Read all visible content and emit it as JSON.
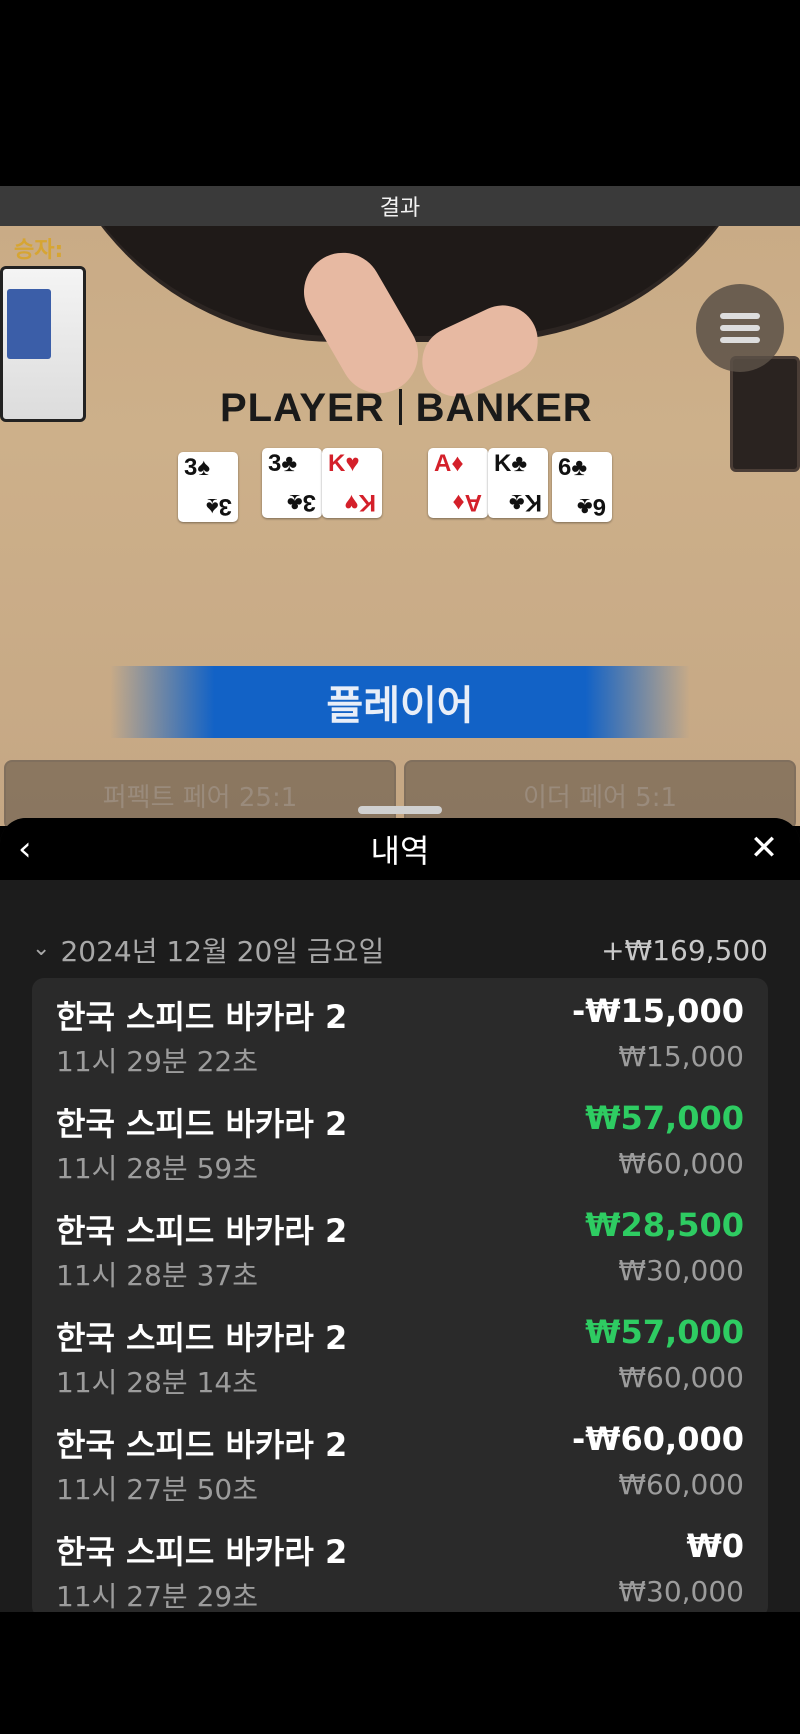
{
  "video": {
    "result_label": "결과",
    "winner_label": "승자:",
    "table_layout": {
      "player": "PLAYER",
      "banker": "BANKER"
    },
    "player_cards": [
      {
        "rank": "3",
        "suit": "♠",
        "color": "black"
      },
      {
        "rank": "3",
        "suit": "♣",
        "color": "black"
      },
      {
        "rank": "K",
        "suit": "♥",
        "color": "red"
      }
    ],
    "banker_cards": [
      {
        "rank": "A",
        "suit": "♦",
        "color": "red"
      },
      {
        "rank": "K",
        "suit": "♣",
        "color": "black"
      },
      {
        "rank": "6",
        "suit": "♣",
        "color": "black"
      }
    ],
    "winner_banner": "플레이어",
    "side_bets": [
      "퍼펙트 페어 25:1",
      "이더 페어 5:1"
    ]
  },
  "sheet": {
    "title": "내역",
    "back_icon": "chevron-left-icon",
    "close_icon": "close-icon",
    "date_group": {
      "date": "2024년 12월 20일 금요일",
      "total": "+₩169,500"
    },
    "rows": [
      {
        "game": "한국 스피드 바카라 2",
        "time": "11시 29분 22초",
        "amount": "-₩15,000",
        "bet": "₩15,000",
        "kind": "loss"
      },
      {
        "game": "한국 스피드 바카라 2",
        "time": "11시 28분 59초",
        "amount": "₩57,000",
        "bet": "₩60,000",
        "kind": "win"
      },
      {
        "game": "한국 스피드 바카라 2",
        "time": "11시 28분 37초",
        "amount": "₩28,500",
        "bet": "₩30,000",
        "kind": "win"
      },
      {
        "game": "한국 스피드 바카라 2",
        "time": "11시 28분 14초",
        "amount": "₩57,000",
        "bet": "₩60,000",
        "kind": "win"
      },
      {
        "game": "한국 스피드 바카라 2",
        "time": "11시 27분 50초",
        "amount": "-₩60,000",
        "bet": "₩60,000",
        "kind": "loss"
      },
      {
        "game": "한국 스피드 바카라 2",
        "time": "11시 27분 29초",
        "amount": "₩0",
        "bet": "₩30,000",
        "kind": "zero"
      }
    ]
  },
  "colors": {
    "win": "#2ecc62",
    "banner_blue": "#1262c6",
    "winner_label": "#d6a533"
  }
}
